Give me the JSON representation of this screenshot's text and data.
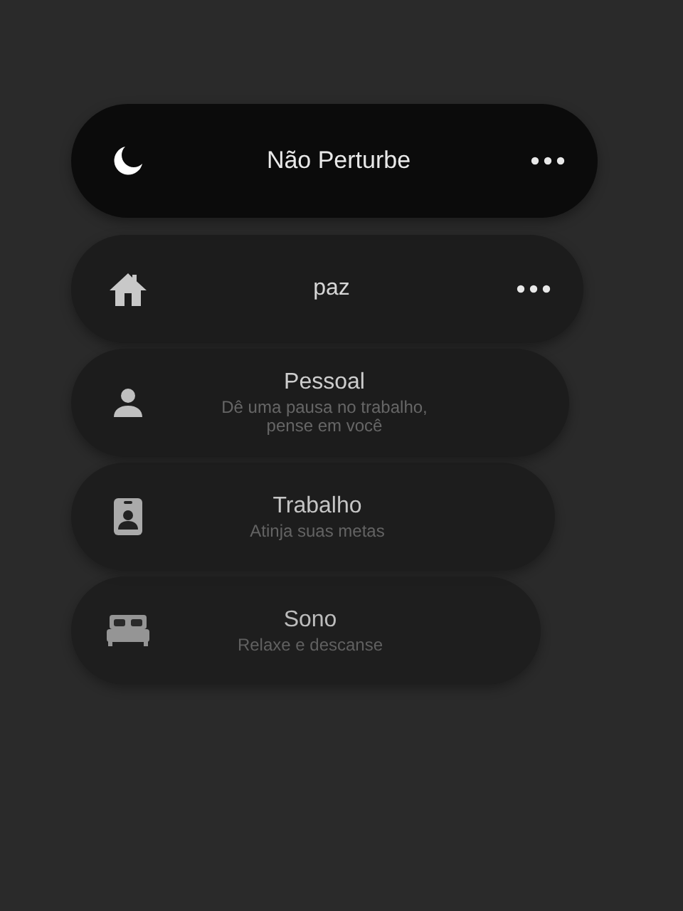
{
  "focus_modes": [
    {
      "kind": "moon",
      "title": "Não Perturbe",
      "more": true,
      "selected": true
    },
    {
      "kind": "house",
      "title": "paz",
      "more": true,
      "selected": false
    },
    {
      "kind": "person",
      "title": "Pessoal",
      "subtitle": "Dê uma pausa no trabalho, pense em você",
      "more": false,
      "selected": false
    },
    {
      "kind": "badge",
      "title": "Trabalho",
      "subtitle": "Atinja suas metas",
      "more": false,
      "selected": false
    },
    {
      "kind": "bed",
      "title": "Sono",
      "subtitle": "Relaxe e descanse",
      "more": false,
      "selected": false
    }
  ]
}
